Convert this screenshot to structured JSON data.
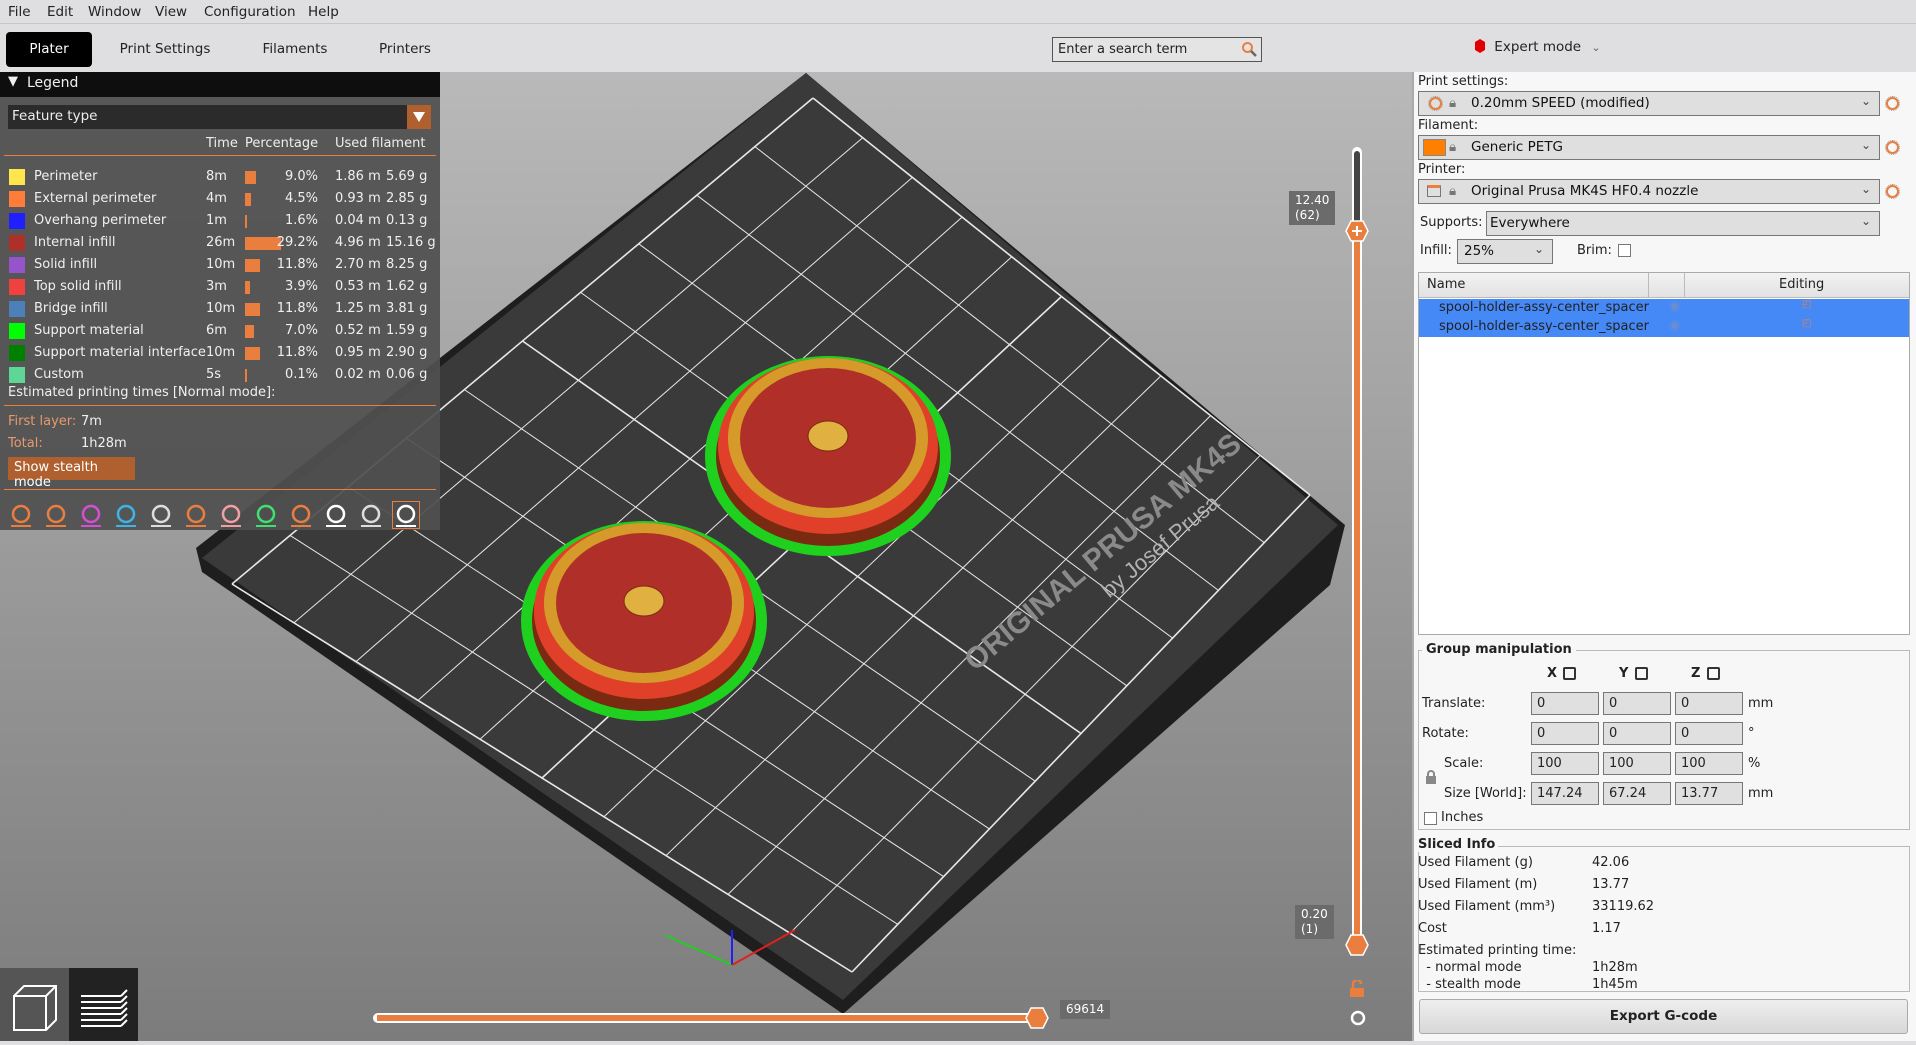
{
  "menu": [
    "File",
    "Edit",
    "Window",
    "View",
    "Configuration",
    "Help"
  ],
  "tabs": [
    "Plater",
    "Print Settings",
    "Filaments",
    "Printers"
  ],
  "search": {
    "placeholder": "Enter a search term"
  },
  "mode": {
    "label": "Expert mode",
    "color": "#e00000"
  },
  "legend": {
    "title": "Legend",
    "view_type": "Feature type",
    "columns": {
      "time": "Time",
      "percentage": "Percentage",
      "used_filament": "Used filament"
    },
    "items": [
      {
        "label": "Perimeter",
        "color": "#ffe64d",
        "time": "8m",
        "percent": 9.0,
        "percent_text": "9.0%",
        "meters": "1.86 m",
        "grams": "5.69 g"
      },
      {
        "label": "External perimeter",
        "color": "#ff7d38",
        "time": "4m",
        "percent": 4.5,
        "percent_text": "4.5%",
        "meters": "0.93 m",
        "grams": "2.85 g"
      },
      {
        "label": "Overhang perimeter",
        "color": "#1f1fff",
        "time": "1m",
        "percent": 1.6,
        "percent_text": "1.6%",
        "meters": "0.04 m",
        "grams": "0.13 g"
      },
      {
        "label": "Internal infill",
        "color": "#b03029",
        "time": "26m",
        "percent": 29.2,
        "percent_text": "29.2%",
        "meters": "4.96 m",
        "grams": "15.16 g"
      },
      {
        "label": "Solid infill",
        "color": "#9654cc",
        "time": "10m",
        "percent": 11.8,
        "percent_text": "11.8%",
        "meters": "2.70 m",
        "grams": "8.25 g"
      },
      {
        "label": "Top solid infill",
        "color": "#f04040",
        "time": "3m",
        "percent": 3.9,
        "percent_text": "3.9%",
        "meters": "0.53 m",
        "grams": "1.62 g"
      },
      {
        "label": "Bridge infill",
        "color": "#4d80ba",
        "time": "10m",
        "percent": 11.8,
        "percent_text": "11.8%",
        "meters": "1.25 m",
        "grams": "3.81 g"
      },
      {
        "label": "Support material",
        "color": "#00ff00",
        "time": "6m",
        "percent": 7.0,
        "percent_text": "7.0%",
        "meters": "0.52 m",
        "grams": "1.59 g"
      },
      {
        "label": "Support material interface",
        "color": "#008000",
        "time": "10m",
        "percent": 11.8,
        "percent_text": "11.8%",
        "meters": "0.95 m",
        "grams": "2.90 g"
      },
      {
        "label": "Custom",
        "color": "#5ed696",
        "time": "5s",
        "percent": 0.1,
        "percent_text": "0.1%",
        "meters": "0.02 m",
        "grams": "0.06 g"
      }
    ],
    "estimated_title": "Estimated printing times [Normal mode]:",
    "first_layer_label": "First layer:",
    "first_layer": "7m",
    "total_label": "Total:",
    "total": "1h28m",
    "stealth_button": "Show stealth mode",
    "toolbar_icons": [
      "travel-icon",
      "wipe-icon",
      "retractions-icon",
      "deretractions-icon",
      "seams-icon",
      "tool-changes-icon",
      "color-changes-icon",
      "pause-icon",
      "custom-gcode-icon",
      "center-of-gravity-icon",
      "shells-icon",
      "tool-marker-icon"
    ]
  },
  "bed": {
    "logo_line1": "ORIGINAL PRUSA MK4S",
    "logo_line2": "by Josef Prusa"
  },
  "layer_slider": {
    "top_value": "12.40",
    "top_layer": "(62)",
    "bottom_value": "0.20",
    "bottom_layer": "(1)"
  },
  "move_slider": {
    "value": "69614"
  },
  "right": {
    "print_settings_label": "Print settings:",
    "print_settings": "0.20mm SPEED (modified)",
    "filament_label": "Filament:",
    "filament": "Generic PETG",
    "filament_color": "#ff8000",
    "printer_label": "Printer:",
    "printer": "Original Prusa MK4S HF0.4 nozzle",
    "supports_label": "Supports:",
    "supports": "Everywhere",
    "infill_label": "Infill:",
    "infill": "25%",
    "brim_label": "Brim:",
    "brim_checked": false,
    "objects": {
      "col_name": "Name",
      "col_editing": "Editing",
      "rows": [
        "spool-holder-assy-center_spacer",
        "spool-holder-assy-center_spacer"
      ]
    },
    "group": {
      "title": "Group manipulation",
      "axes": [
        "X",
        "Y",
        "Z"
      ],
      "translate_label": "Translate:",
      "translate": [
        "0",
        "0",
        "0"
      ],
      "translate_unit": "mm",
      "rotate_label": "Rotate:",
      "rotate": [
        "0",
        "0",
        "0"
      ],
      "rotate_unit": "°",
      "scale_label": "Scale:",
      "scale": [
        "100",
        "100",
        "100"
      ],
      "scale_unit": "%",
      "size_label": "Size [World]:",
      "size": [
        "147.24",
        "67.24",
        "13.77"
      ],
      "size_unit": "mm",
      "inches_label": "Inches"
    },
    "sliced": {
      "title": "Sliced Info",
      "rows": [
        {
          "label": "Used Filament (g)",
          "value": "42.06"
        },
        {
          "label": "Used Filament (m)",
          "value": "13.77"
        },
        {
          "label": "Used Filament (mm³)",
          "value": "33119.62"
        },
        {
          "label": "Cost",
          "value": "1.17"
        },
        {
          "label": "Estimated printing time:",
          "value": ""
        },
        {
          "label": "  - normal mode",
          "value": "1h28m"
        },
        {
          "label": "  - stealth mode",
          "value": "1h45m"
        }
      ]
    },
    "export_label": "Export G-code"
  }
}
